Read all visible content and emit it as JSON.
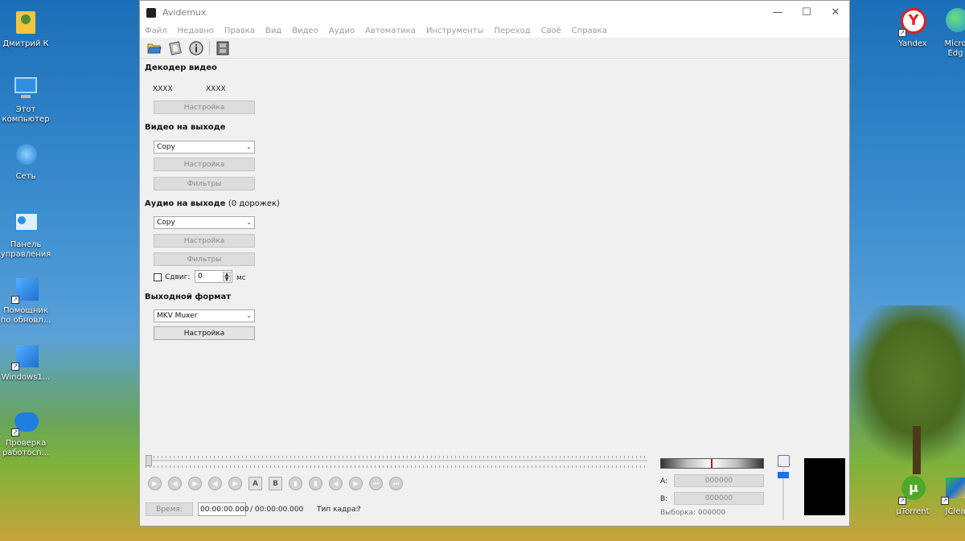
{
  "desktop": {
    "icons_left": [
      {
        "label": "Дмитрий К",
        "icon": "user-folder-icon"
      },
      {
        "label": "Этот компьютер",
        "icon": "computer-icon"
      },
      {
        "label": "Сеть",
        "icon": "network-icon"
      },
      {
        "label": "Панель управления",
        "icon": "control-panel-icon"
      },
      {
        "label": "Помощник по обновл...",
        "icon": "windows-update-icon"
      },
      {
        "label": "Windows1...",
        "icon": "windows-icon"
      },
      {
        "label": "Проверка работосп...",
        "icon": "health-check-icon"
      }
    ],
    "icons_right": [
      {
        "label": "Yandex",
        "icon": "yandex-icon"
      },
      {
        "label": "Micro Edg",
        "icon": "edge-icon"
      },
      {
        "label": "µTorrent",
        "icon": "utorrent-icon"
      },
      {
        "label": "JClea",
        "icon": "jcleaner-icon"
      }
    ]
  },
  "window": {
    "title": "Avidemux",
    "controls": {
      "minimize": "—",
      "maximize": "☐",
      "close": "✕"
    },
    "menu": [
      "Файл",
      "Недавно",
      "Правка",
      "Вид",
      "Видео",
      "Аудио",
      "Автоматика",
      "Инструменты",
      "Переход",
      "Своё",
      "Справка"
    ],
    "toolbar": [
      {
        "icon": "open-folder-icon"
      },
      {
        "icon": "save-film-icon"
      },
      {
        "icon": "info-icon"
      },
      {
        "icon": "film-strip-icon"
      }
    ]
  },
  "video_decoder": {
    "title": "Декодер видео",
    "codec1": "XXXX",
    "codec2": "XXXX",
    "configure": "Настройка"
  },
  "video_output": {
    "title": "Видео на выходе",
    "selected": "Copy",
    "configure": "Настройка",
    "filters": "Фильтры"
  },
  "audio_output": {
    "title": "Аудио на выходе",
    "tracks": "(0 дорожек)",
    "selected": "Copy",
    "configure": "Настройка",
    "filters": "Фильтры",
    "shift_label": "Сдвиг:",
    "shift_value": "0",
    "shift_unit": "мс"
  },
  "output_format": {
    "title": "Выходной формат",
    "selected": "MKV Muxer",
    "configure": "Настройка"
  },
  "playback": {
    "nav_buttons": [
      {
        "icon": "play-icon",
        "glyph": "▶"
      },
      {
        "icon": "rewind-icon",
        "glyph": "◀"
      },
      {
        "icon": "forward-icon",
        "glyph": "▶"
      },
      {
        "icon": "prev-frame-icon",
        "glyph": "◀"
      },
      {
        "icon": "next-frame-icon",
        "glyph": "▶"
      },
      {
        "icon": "marker-a-icon",
        "glyph": "A"
      },
      {
        "icon": "marker-b-icon",
        "glyph": "B"
      },
      {
        "icon": "prev-keyframe-icon",
        "glyph": "▮"
      },
      {
        "icon": "next-keyframe-icon",
        "glyph": "▮"
      },
      {
        "icon": "goto-a-icon",
        "glyph": "◀"
      },
      {
        "icon": "goto-b-icon",
        "glyph": "▶"
      },
      {
        "icon": "first-frame-icon",
        "glyph": "⏮"
      },
      {
        "icon": "last-frame-icon",
        "glyph": "⏭"
      }
    ],
    "time_label": "Время:",
    "current_time": "00:00:00.000",
    "total_time": "/ 00:00:00.000",
    "frame_type_label": "Тип кадра:",
    "frame_type_value": "?",
    "a_label": "A:",
    "a_value": "000000",
    "b_label": "B:",
    "b_value": "000000",
    "selection": "Выборка: 000000"
  }
}
